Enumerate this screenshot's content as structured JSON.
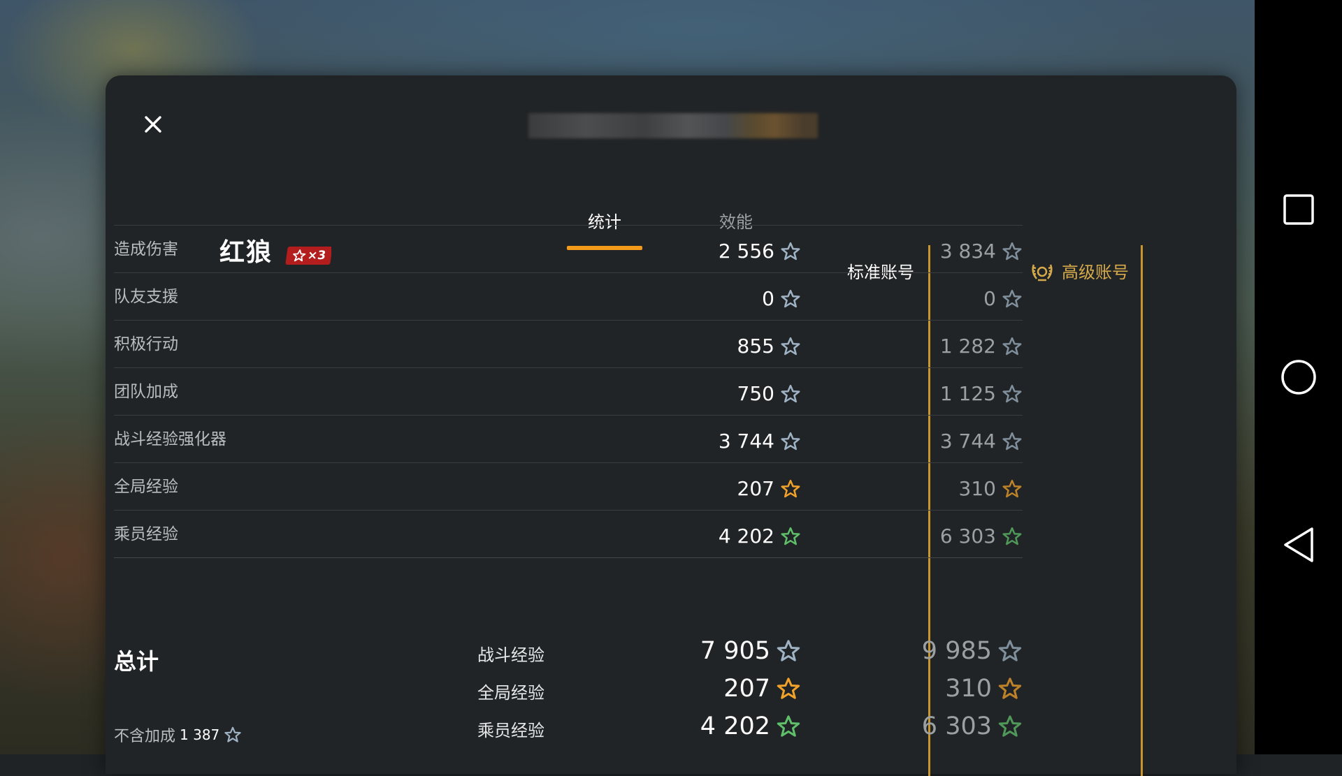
{
  "tabs": {
    "stats": "统计",
    "efficiency": "效能"
  },
  "vehicle": {
    "name": "红狼",
    "badge": "×3"
  },
  "columns": {
    "standard": "标准账号",
    "premium": "高级账号"
  },
  "rows": [
    {
      "label": "造成伤害",
      "standard": "2 556",
      "premium": "3 834",
      "star": "silver"
    },
    {
      "label": "队友支援",
      "standard": "0",
      "premium": "0",
      "star": "silver"
    },
    {
      "label": "积极行动",
      "standard": "855",
      "premium": "1 282",
      "star": "silver"
    },
    {
      "label": "团队加成",
      "standard": "750",
      "premium": "1 125",
      "star": "silver"
    },
    {
      "label": "战斗经验强化器",
      "standard": "3 744",
      "premium": "3 744",
      "star": "silver"
    },
    {
      "label": "全局经验",
      "standard": "207",
      "premium": "310",
      "star": "gold"
    },
    {
      "label": "乘员经验",
      "standard": "4 202",
      "premium": "6 303",
      "star": "green"
    }
  ],
  "totals": {
    "title": "总计",
    "no_bonus_label": "不含加成",
    "no_bonus_value": "1 387",
    "lines": [
      {
        "label": "战斗经验",
        "standard": "7 905",
        "premium": "9 985",
        "star": "silver"
      },
      {
        "label": "全局经验",
        "standard": "207",
        "premium": "310",
        "star": "gold"
      },
      {
        "label": "乘员经验",
        "standard": "4 202",
        "premium": "6 303",
        "star": "green"
      }
    ]
  },
  "colors": {
    "accent": "#f39a1a",
    "premium": "#d6a94a",
    "silver_star": "#9fb3c4",
    "gold_star": "#f0a22a",
    "green_star": "#5fbf6a"
  },
  "icons": {
    "close": "close-icon",
    "premium": "laurel-icon",
    "star": "star-icon"
  }
}
